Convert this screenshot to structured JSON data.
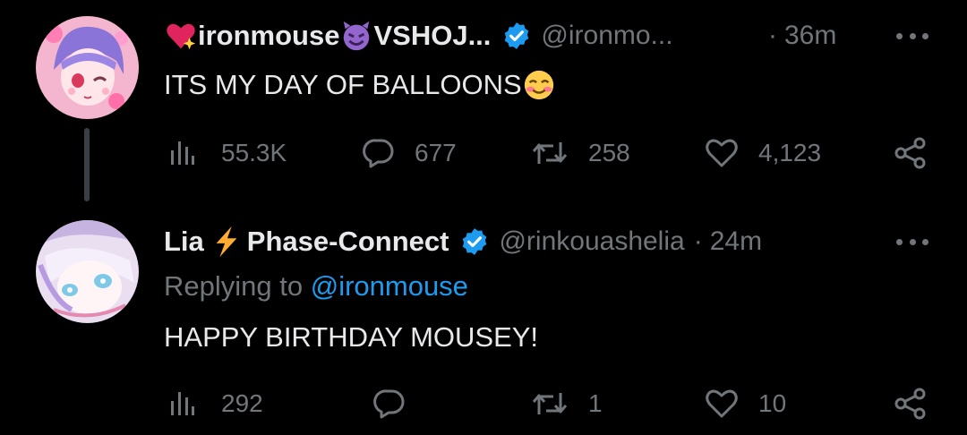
{
  "tweets": [
    {
      "avatar": "ironmouse-avatar",
      "name": "ironmouse",
      "name_suffix": "VSHOJ...",
      "handle": "@ironmo...",
      "time": "36m",
      "text": "ITS MY DAY OF BALLOONS",
      "stats": {
        "views": "55.3K",
        "replies": "677",
        "retweets": "258",
        "likes": "4,123"
      }
    },
    {
      "avatar": "lia-avatar",
      "name": "Lia",
      "name_suffix": "Phase-Connect",
      "handle": "@rinkouashelia",
      "time": "24m",
      "replying_prefix": "Replying to",
      "replying_to": "@ironmouse",
      "text": "HAPPY BIRTHDAY MOUSEY!",
      "stats": {
        "views": "292",
        "replies": "",
        "retweets": "1",
        "likes": "10"
      }
    }
  ],
  "separator": "·",
  "colors": {
    "background": "#000000",
    "text": "#e7e9ea",
    "muted": "#71767b",
    "accent": "#1d9bf0"
  },
  "icons": [
    "sparkling-heart-icon",
    "smiling-devil-icon",
    "verified-icon",
    "smiling-face-icon",
    "lightning-icon",
    "views-icon",
    "reply-icon",
    "retweet-icon",
    "like-icon",
    "share-icon",
    "more-icon"
  ]
}
